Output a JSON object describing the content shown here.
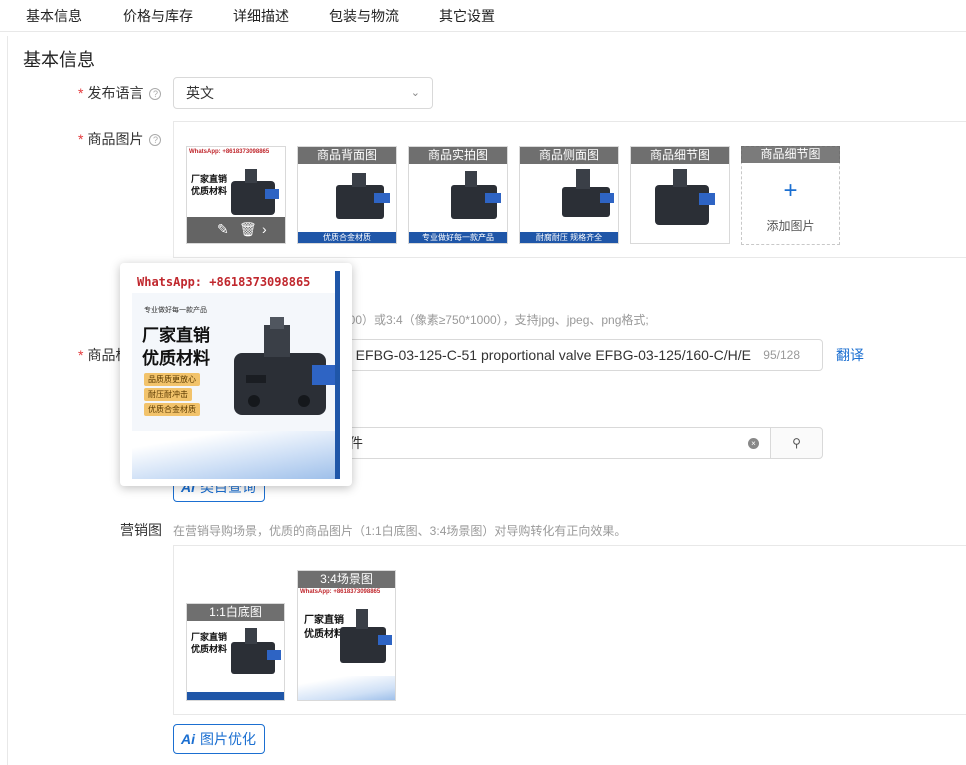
{
  "tabs": [
    "基本信息",
    "价格与库存",
    "详细描述",
    "包装与物流",
    "其它设置"
  ],
  "section_title": "基本信息",
  "publish_lang": {
    "label": "发布语言",
    "value": "英文"
  },
  "product_images": {
    "label": "商品图片",
    "tiles": [
      {
        "caption": ""
      },
      {
        "caption": "商品背面图",
        "footer": "优质合金材质"
      },
      {
        "caption": "商品实拍图",
        "footer": "专业做好每一款产品"
      },
      {
        "caption": "商品侧面图",
        "footer": "耐腐耐压 规格齐全"
      },
      {
        "caption": "商品细节图"
      }
    ],
    "add_tile": {
      "caption": "商品细节图",
      "text": "添加图片"
    },
    "hint": "800）或3:4（像素≥750*1000），支持jpg、jpeg、png格式;"
  },
  "product_title": {
    "label": "商品标题",
    "value": "e EFBG-03-125-C-51 proportional valve EFBG-03-125/160-C/H/E",
    "count": "95/128",
    "translate": "翻译"
  },
  "category": {
    "value": "件",
    "button_label": "类目查询"
  },
  "marketing": {
    "label": "营销图",
    "hint": "在营销导购场景，优质的商品图片（1:1白底图、3:4场景图）对导购转化有正向效果。",
    "tile1": "1:1白底图",
    "tile2": "3:4场景图",
    "optimize_button": "图片优化"
  },
  "popup": {
    "whatsapp": "WhatsApp: +8618373098865",
    "slogan": "专业做好每一款产品",
    "line1": "厂家直销",
    "line2": "优质材料",
    "tags": [
      "品质质更放心",
      "耐压耐冲击",
      "优质合金材质"
    ]
  },
  "colors": {
    "accent": "#1b6fd1",
    "required": "#e4393c",
    "brand_blue": "#1f56a8"
  }
}
